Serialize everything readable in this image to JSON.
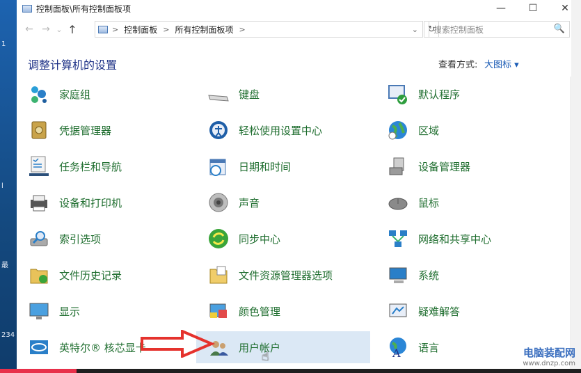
{
  "window": {
    "title": "控制面板\\所有控制面板项",
    "buttons": {
      "minimize": "—",
      "maximize": "☐",
      "close": "✕"
    }
  },
  "nav": {
    "back": "←",
    "forward": "→",
    "dropdown": "⌄",
    "up": "↑"
  },
  "address": {
    "crumbs": [
      "控制面板",
      "所有控制面板项"
    ],
    "separator": ">",
    "dropdown": "⌄",
    "refresh": "↻"
  },
  "search": {
    "placeholder": "搜索控制面板",
    "icon": "🔍"
  },
  "header": {
    "title": "调整计算机的设置",
    "view_by_label": "查看方式:",
    "view_by_value": "大图标 ▾"
  },
  "items": [
    {
      "label": "家庭组",
      "icon": "homegroup-icon"
    },
    {
      "label": "键盘",
      "icon": "keyboard-icon"
    },
    {
      "label": "默认程序",
      "icon": "default-programs-icon"
    },
    {
      "label": "凭据管理器",
      "icon": "credential-manager-icon"
    },
    {
      "label": "轻松使用设置中心",
      "icon": "ease-of-access-icon"
    },
    {
      "label": "区域",
      "icon": "region-globe-icon"
    },
    {
      "label": "任务栏和导航",
      "icon": "taskbar-icon"
    },
    {
      "label": "日期和时间",
      "icon": "date-time-icon"
    },
    {
      "label": "设备管理器",
      "icon": "device-manager-icon"
    },
    {
      "label": "设备和打印机",
      "icon": "printer-icon"
    },
    {
      "label": "声音",
      "icon": "speaker-icon"
    },
    {
      "label": "鼠标",
      "icon": "mouse-icon"
    },
    {
      "label": "索引选项",
      "icon": "indexing-icon"
    },
    {
      "label": "同步中心",
      "icon": "sync-icon"
    },
    {
      "label": "网络和共享中心",
      "icon": "network-icon"
    },
    {
      "label": "文件历史记录",
      "icon": "file-history-icon"
    },
    {
      "label": "文件资源管理器选项",
      "icon": "folder-options-icon"
    },
    {
      "label": "系统",
      "icon": "system-icon"
    },
    {
      "label": "显示",
      "icon": "display-icon"
    },
    {
      "label": "颜色管理",
      "icon": "color-management-icon"
    },
    {
      "label": "疑难解答",
      "icon": "troubleshooting-icon"
    },
    {
      "label": "英特尔® 核芯显卡",
      "icon": "intel-graphics-icon"
    },
    {
      "label": "用户帐户",
      "icon": "user-accounts-icon"
    },
    {
      "label": "语言",
      "icon": "language-icon"
    }
  ],
  "desktop": {
    "text1": "1",
    "text2": "l",
    "text3": "最",
    "text4": "234"
  },
  "watermark": {
    "line1": "电脑装配网",
    "line2": "www.dnzp.com"
  },
  "colors": {
    "accent": "#1a5bb5",
    "link_green": "#1f6e2f",
    "title_blue": "#1e3287",
    "hover": "#dbe8f5",
    "annotation": "#e5322d"
  }
}
